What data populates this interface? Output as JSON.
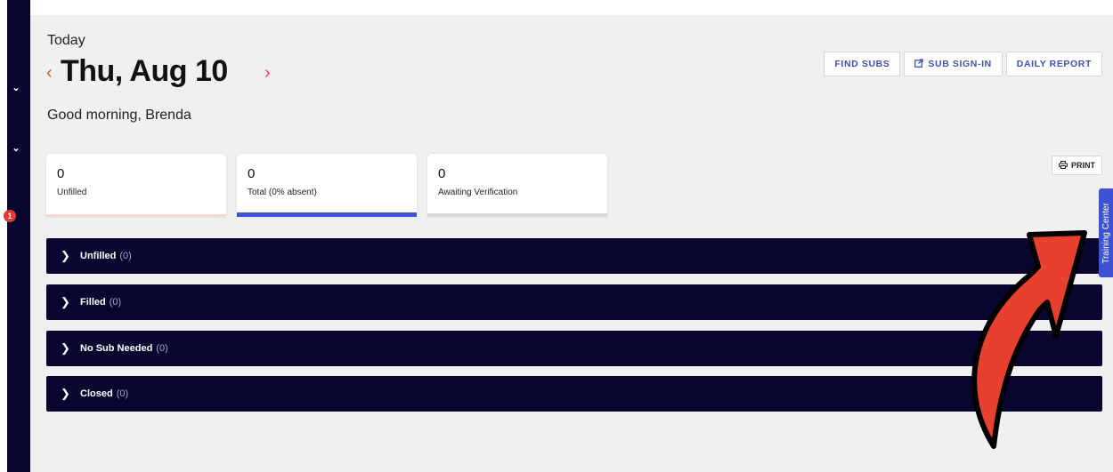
{
  "header": {
    "today_label": "Today",
    "date": "Thu, Aug 10",
    "prev_icon": "‹",
    "next_icon": "›",
    "greeting": "Good morning, Brenda"
  },
  "sidebar": {
    "chevron_icon": "⌄",
    "badge_count": "1"
  },
  "actions": {
    "find_subs": "FIND SUBS",
    "sub_signin": "SUB SIGN-IN",
    "daily_report": "DAILY REPORT",
    "print": "PRINT",
    "sub_signin_icon": "external-link-icon",
    "print_icon": "printer-icon"
  },
  "stats": [
    {
      "value": "0",
      "label": "Unfilled",
      "bar_color": "#f4d6d3"
    },
    {
      "value": "0",
      "label": "Total (0% absent)",
      "bar_color": "#4052d6"
    },
    {
      "value": "0",
      "label": "Awaiting Verification",
      "bar_color": "#d8d8d8"
    }
  ],
  "sections": [
    {
      "name": "Unfilled",
      "count": "(0)"
    },
    {
      "name": "Filled",
      "count": "(0)"
    },
    {
      "name": "No Sub Needed",
      "count": "(0)"
    },
    {
      "name": "Closed",
      "count": "(0)"
    }
  ],
  "training_center": "Training Center",
  "colors": {
    "sidebar": "#08062e",
    "accent_red": "#e94a3f",
    "button_text": "#4052b5",
    "training_tab": "#3d52d5",
    "arrow": "#e8402f"
  }
}
